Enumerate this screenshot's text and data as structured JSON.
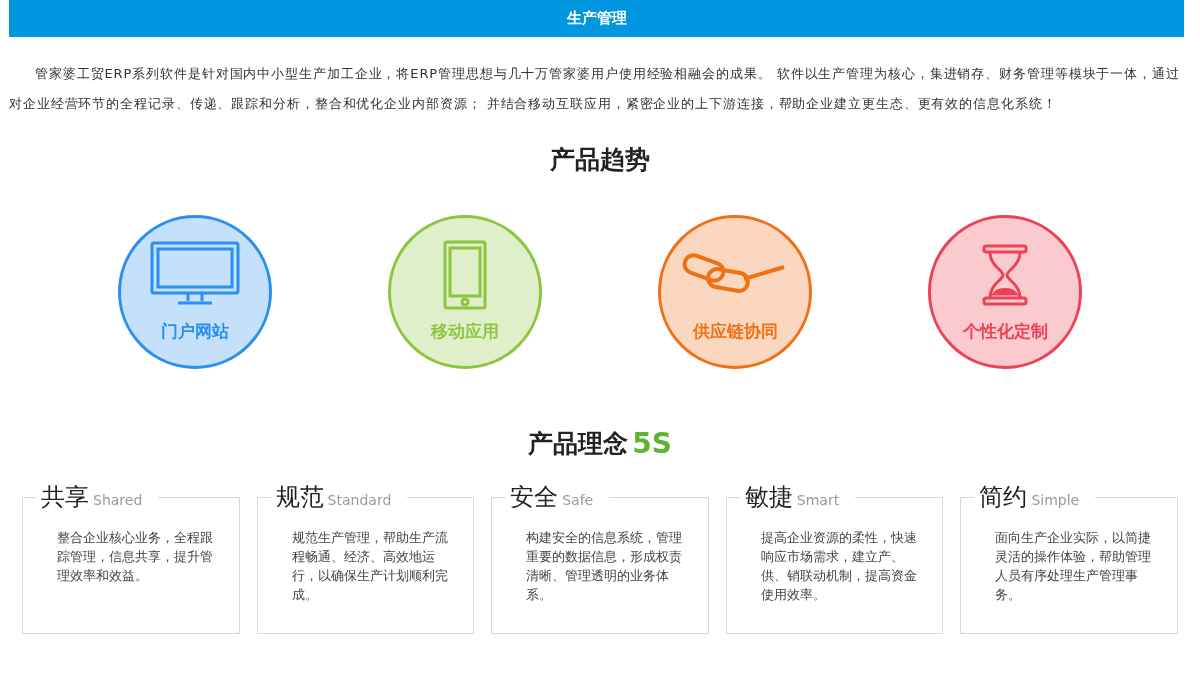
{
  "header": {
    "title": "生产管理"
  },
  "intro": "管家婆工贸ERP系列软件是针对国内中小型生产加工企业，将ERP管理思想与几十万管家婆用户使用经验相融会的成果。 软件以生产管理为核心，集进销存、财务管理等模块于一体，通过对企业经营环节的全程记录、传递、跟踪和分析，整合和优化企业内部资源； 并结合移动互联应用，紧密企业的上下游连接，帮助企业建立更生态、更有效的信息化系统！",
  "trends": {
    "title": "产品趋势",
    "items": [
      {
        "label": "门户网站",
        "kind": "monitor",
        "color": "#2b8ff0"
      },
      {
        "label": "移动应用",
        "kind": "phone",
        "color": "#8cc63f"
      },
      {
        "label": "供应链协同",
        "kind": "chain",
        "color": "#ee7116"
      },
      {
        "label": "个性化定制",
        "kind": "hourglass",
        "color": "#ec4255"
      }
    ]
  },
  "concept": {
    "title": "产品理念",
    "badge": "5S",
    "cards": [
      {
        "title": "共享",
        "subtitle": "Shared",
        "text": "整合企业核心业务，全程跟踪管理，信息共享，提升管理效率和效益。"
      },
      {
        "title": "规范",
        "subtitle": "Standard",
        "text": "规范生产管理，帮助生产流程畅通、经济、高效地运行，以确保生产计划顺利完成。"
      },
      {
        "title": "安全",
        "subtitle": "Safe",
        "text": "构建安全的信息系统，管理重要的数据信息，形成权责清晰、管理透明的业务体系。"
      },
      {
        "title": "敏捷",
        "subtitle": "Smart",
        "text": "提高企业资源的柔性，快速响应市场需求，建立产、供、销联动机制，提高资金使用效率。"
      },
      {
        "title": "简约",
        "subtitle": "Simple",
        "text": "面向生产企业实际，以简捷灵活的操作体验，帮助管理人员有序处理生产管理事务。"
      }
    ]
  }
}
